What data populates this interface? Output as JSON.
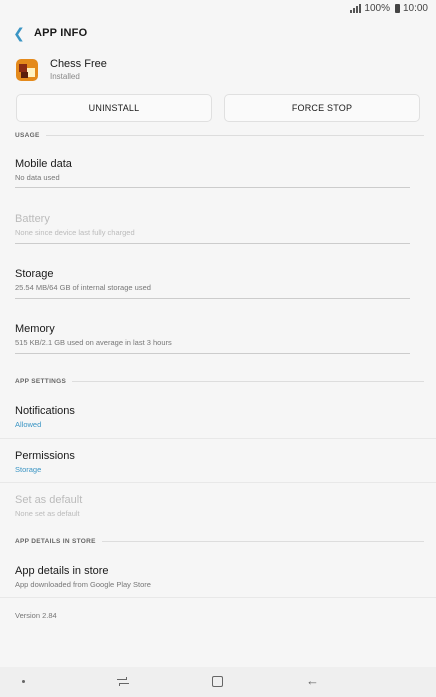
{
  "status_bar": {
    "battery": "100%",
    "time": "10:00"
  },
  "header": {
    "title": "APP INFO"
  },
  "app": {
    "name": "Chess Free",
    "status": "Installed"
  },
  "buttons": {
    "uninstall": "UNINSTALL",
    "force_stop": "FORCE STOP"
  },
  "sections": {
    "usage": "USAGE",
    "app_settings": "APP SETTINGS",
    "app_details": "APP DETAILS IN STORE"
  },
  "usage_items": [
    {
      "title": "Mobile data",
      "subtitle": "No data used"
    },
    {
      "title": "Battery",
      "subtitle": "None since device last fully charged"
    },
    {
      "title": "Storage",
      "subtitle": "25.54 MB/64 GB of internal storage used"
    },
    {
      "title": "Memory",
      "subtitle": "515 KB/2.1 GB used on average in last 3 hours"
    }
  ],
  "settings_items": [
    {
      "title": "Notifications",
      "subtitle": "Allowed"
    },
    {
      "title": "Permissions",
      "subtitle": "Storage"
    },
    {
      "title": "Set as default",
      "subtitle": "None set as default"
    }
  ],
  "store_item": {
    "title": "App details in store",
    "subtitle": "App downloaded from Google Play Store"
  },
  "version": "Version 2.84",
  "colors": {
    "accent": "#3b95c4",
    "background": "#f6f6f6",
    "disabled_text": "#bbbbbb"
  }
}
